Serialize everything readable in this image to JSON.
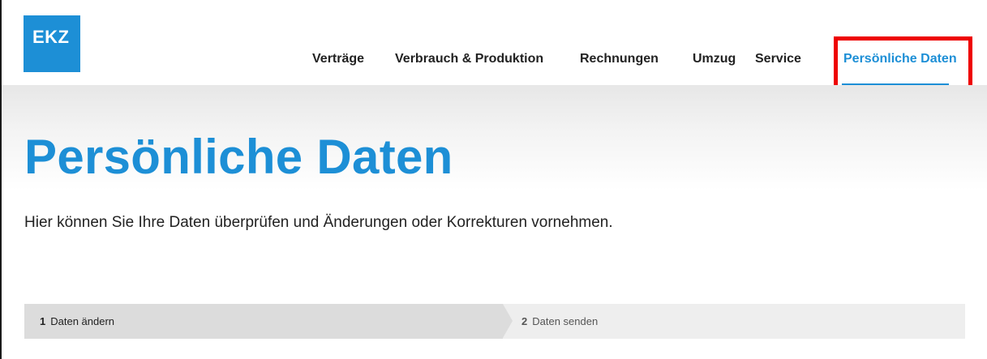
{
  "brand": {
    "logo_text": "EKZ",
    "accent_color": "#1d8fd6",
    "highlight_color": "#ee0000"
  },
  "nav": {
    "items": [
      {
        "label": "Verträge"
      },
      {
        "label": "Verbrauch & Produktion"
      },
      {
        "label": "Rechnungen"
      },
      {
        "label": "Umzug"
      },
      {
        "label": "Service"
      },
      {
        "label": "Persönliche Daten",
        "active": true
      }
    ]
  },
  "page": {
    "title": "Persönliche Daten",
    "intro": "Hier können Sie Ihre Daten überprüfen und Änderungen oder Korrekturen vornehmen."
  },
  "steps": [
    {
      "number": "1",
      "label": "Daten ändern",
      "active": true
    },
    {
      "number": "2",
      "label": "Daten senden",
      "active": false
    }
  ]
}
